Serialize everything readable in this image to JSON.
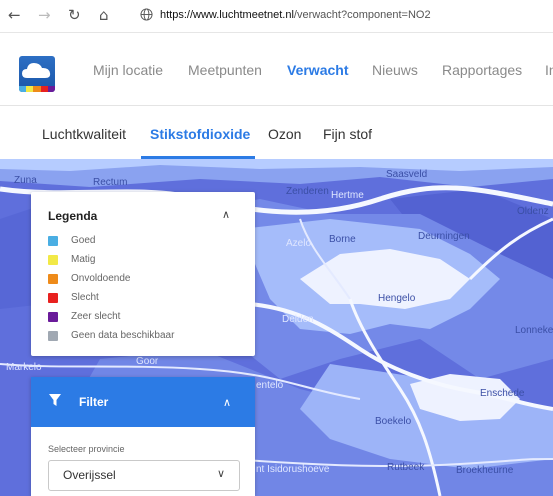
{
  "browser": {
    "url_host": "https://www.luchtmeetnet.nl",
    "url_path": "/verwacht?component=NO2"
  },
  "nav": {
    "items": [
      "Mijn locatie",
      "Meetpunten",
      "Verwacht",
      "Nieuws",
      "Rapportages",
      "In"
    ],
    "active": "Verwacht"
  },
  "subtabs": {
    "items": [
      "Luchtkwaliteit",
      "Stikstofdioxide",
      "Ozon",
      "Fijn stof"
    ],
    "active": "Stikstofdioxide"
  },
  "map": {
    "places": [
      "Zuna",
      "Rectum",
      "Saasveld",
      "Zenderen",
      "Hertme",
      "Oldenz",
      "Azelo",
      "Borne",
      "Deurningen",
      "Hengelo",
      "Delden",
      "Lonneke",
      "Markelo",
      "Goor",
      "entelo",
      "Enschede",
      "Boekelo",
      "nt Isidorushoeve",
      "Rutbeek",
      "Broekheurne"
    ],
    "colors": {
      "good": "#aec6ff",
      "moderate": "#8aa2f0",
      "base": "#5f6fdc",
      "dark": "#4c56c8",
      "urban": "#ffffff"
    }
  },
  "legend": {
    "title": "Legenda",
    "items": [
      {
        "label": "Goed",
        "color": "#4aaee3"
      },
      {
        "label": "Matig",
        "color": "#f2e947"
      },
      {
        "label": "Onvoldoende",
        "color": "#ee8b1a"
      },
      {
        "label": "Slecht",
        "color": "#e8211f"
      },
      {
        "label": "Zeer slecht",
        "color": "#6a1b9a"
      },
      {
        "label": "Geen data beschikbaar",
        "color": "#a0a8b2"
      }
    ]
  },
  "filter": {
    "title": "Filter",
    "province_label": "Selecteer provincie",
    "province_value": "Overijssel"
  }
}
